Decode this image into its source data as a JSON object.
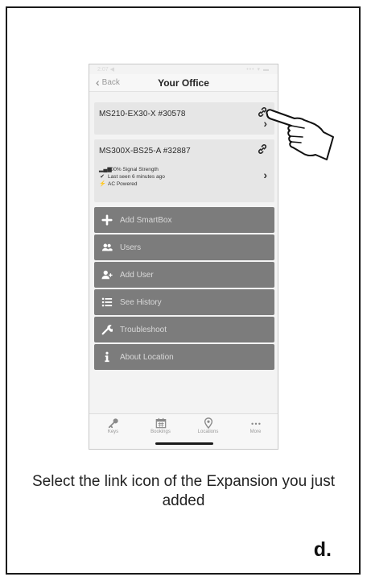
{
  "phone": {
    "statusbar": {
      "time": "2:07 ◀",
      "icons": "••• ▾ ▬"
    },
    "navbar": {
      "back_label": "Back",
      "title": "Your Office"
    },
    "devices": [
      {
        "name": "MS210-EX30-X #30578",
        "icon": "link-icon"
      },
      {
        "name": "MS300X-BS25-A #32887",
        "icon": "link-icon",
        "signal": "100% Signal Strength",
        "last_seen": "Last seen 6 minutes ago",
        "power": "AC Powered"
      }
    ],
    "menu": [
      {
        "label": "Add SmartBox",
        "icon": "plus-icon"
      },
      {
        "label": "Users",
        "icon": "users-icon"
      },
      {
        "label": "Add User",
        "icon": "add-user-icon"
      },
      {
        "label": "See History",
        "icon": "list-icon"
      },
      {
        "label": "Troubleshoot",
        "icon": "wrench-icon"
      },
      {
        "label": "About Location",
        "icon": "info-icon"
      }
    ],
    "tabbar": [
      {
        "label": "Keys",
        "icon": "key-icon"
      },
      {
        "label": "Bookings",
        "icon": "calendar-icon"
      },
      {
        "label": "Locations",
        "icon": "location-pin-icon"
      },
      {
        "label": "More",
        "icon": "more-icon"
      }
    ]
  },
  "caption": "Select the link icon of the Expansion you just added",
  "step": "d."
}
